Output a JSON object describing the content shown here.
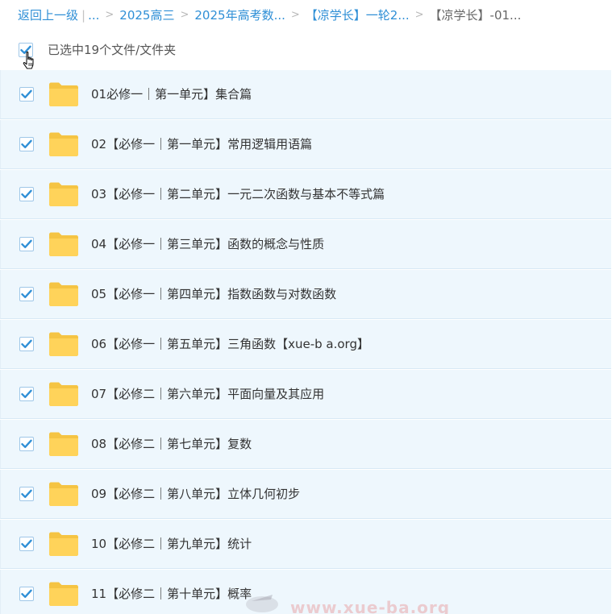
{
  "breadcrumb": {
    "back_label": "返回上一级",
    "ellipsis": "...",
    "items": [
      "2025高三",
      "2025年高考数...",
      "【凉学长】一轮2...",
      "【凉学长】-01..."
    ]
  },
  "selection": {
    "summary": "已选中19个文件/文件夹",
    "all_checked": true
  },
  "files": [
    {
      "name": "01必修一｜第一单元】集合篇",
      "checked": true,
      "type": "folder"
    },
    {
      "name": "02【必修一｜第一单元】常用逻辑用语篇",
      "checked": true,
      "type": "folder"
    },
    {
      "name": "03【必修一｜第二单元】一元二次函数与基本不等式篇",
      "checked": true,
      "type": "folder"
    },
    {
      "name": "04【必修一｜第三单元】函数的概念与性质",
      "checked": true,
      "type": "folder"
    },
    {
      "name": "05【必修一｜第四单元】指数函数与对数函数",
      "checked": true,
      "type": "folder"
    },
    {
      "name": "06【必修一｜第五单元】三角函数【xue-b a.org】",
      "checked": true,
      "type": "folder"
    },
    {
      "name": "07【必修二｜第六单元】平面向量及其应用",
      "checked": true,
      "type": "folder"
    },
    {
      "name": "08【必修二｜第七单元】复数",
      "checked": true,
      "type": "folder"
    },
    {
      "name": "09【必修二｜第八单元】立体几何初步",
      "checked": true,
      "type": "folder"
    },
    {
      "name": "10【必修二｜第九单元】统计",
      "checked": true,
      "type": "folder"
    },
    {
      "name": "11【必修二｜第十单元】概率",
      "checked": true,
      "type": "folder"
    }
  ],
  "watermark": "www.xue-ba.org",
  "colors": {
    "link": "#2f8fd6",
    "row_background": "#eef7fd",
    "check": "#2f8fd6",
    "folder": "#ffd35a"
  },
  "icons": {
    "checkbox": "checkbox-checked-icon",
    "folder": "folder-icon",
    "cursor": "hand-pointer-icon"
  }
}
